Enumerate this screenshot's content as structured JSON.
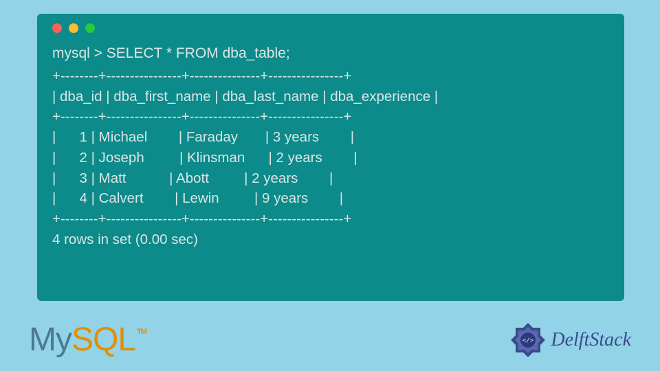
{
  "terminal": {
    "prompt": "mysql > SELECT * FROM dba_table;",
    "border_top": "+--------+----------------+---------------+----------------+",
    "header_row": "| dba_id | dba_first_name | dba_last_name | dba_experience |",
    "border_mid": "+--------+----------------+---------------+----------------+",
    "row1": "|      1 | Michael        | Faraday       | 3 years        |",
    "row2": "|      2 | Joseph         | Klinsman      | 2 years        |",
    "row3": "|      3 | Matt           | Abott         | 2 years        |",
    "row4": "|      4 | Calvert        | Lewin         | 9 years        |",
    "border_bot": "+--------+----------------+---------------+----------------+",
    "footer": "4 rows in set (0.00 sec)"
  },
  "chart_data": {
    "type": "table",
    "title": "dba_table",
    "columns": [
      "dba_id",
      "dba_first_name",
      "dba_last_name",
      "dba_experience"
    ],
    "rows": [
      [
        1,
        "Michael",
        "Faraday",
        "3 years"
      ],
      [
        2,
        "Joseph",
        "Klinsman",
        "2 years"
      ],
      [
        3,
        "Matt",
        "Abott",
        "2 years"
      ],
      [
        4,
        "Calvert",
        "Lewin",
        "9 years"
      ]
    ],
    "row_count": 4,
    "query_time_sec": 0.0,
    "query": "SELECT * FROM dba_table;"
  },
  "logos": {
    "mysql_my": "My",
    "mysql_sql": "SQL",
    "mysql_tm": "TM",
    "delft": "DelftStack"
  }
}
